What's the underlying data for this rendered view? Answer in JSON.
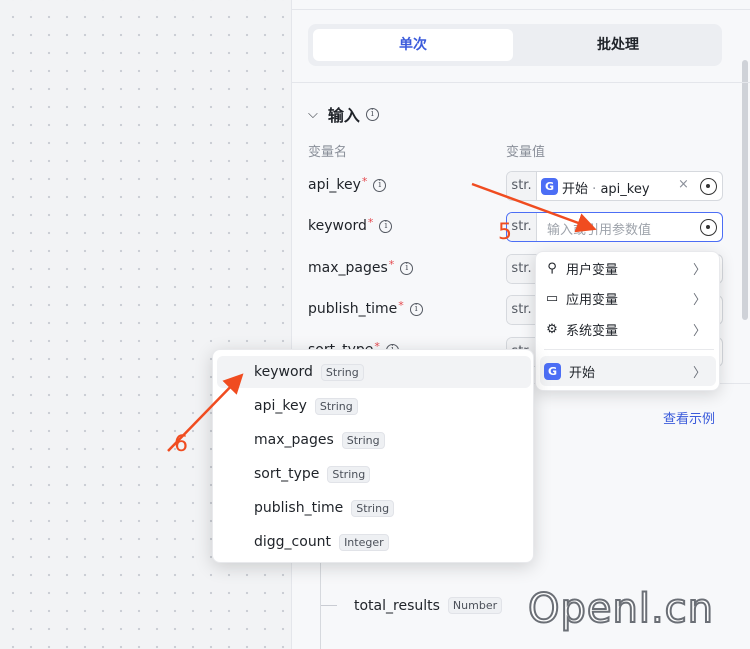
{
  "tabs": {
    "single": "单次",
    "batch": "批处理"
  },
  "input_section": {
    "title": "输入"
  },
  "columns": {
    "name": "变量名",
    "value": "变量值"
  },
  "variables": [
    {
      "name": "api_key",
      "type": "str.",
      "ref_node": "开始",
      "ref_sep": "·",
      "ref_var": "api_key",
      "clear": "×"
    },
    {
      "name": "keyword",
      "type": "str.",
      "placeholder": "输入或引用参数值"
    },
    {
      "name": "max_pages",
      "type": "str."
    },
    {
      "name": "publish_time",
      "type": "str."
    },
    {
      "name": "sort_type",
      "type": "str."
    }
  ],
  "required_mark": "*",
  "variable_menu": {
    "items": [
      {
        "label": "用户变量",
        "icon": "user-icon"
      },
      {
        "label": "应用变量",
        "icon": "folder-icon"
      },
      {
        "label": "系统变量",
        "icon": "gear-icon"
      }
    ],
    "start": "开始"
  },
  "keyword_menu": [
    {
      "name": "keyword",
      "type": "String"
    },
    {
      "name": "api_key",
      "type": "String"
    },
    {
      "name": "max_pages",
      "type": "String"
    },
    {
      "name": "sort_type",
      "type": "String"
    },
    {
      "name": "publish_time",
      "type": "String"
    },
    {
      "name": "digg_count",
      "type": "Integer"
    }
  ],
  "link": "查看示例",
  "output": {
    "name": "total_results",
    "type": "Number"
  },
  "annotations": {
    "step5": "5",
    "step6": "6"
  },
  "watermark": "Openl.cn",
  "colors": {
    "accent": "#3b5bdb",
    "annotation": "#f04c20",
    "required": "#e5484d"
  }
}
